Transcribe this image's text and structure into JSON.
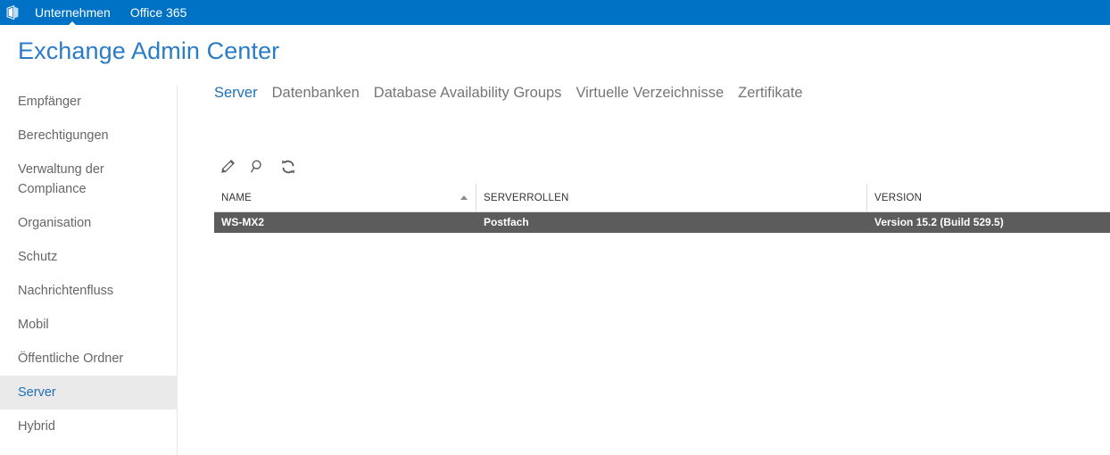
{
  "suite_bar": {
    "logo_icon": "office-logo-icon",
    "links": [
      {
        "label": "Unternehmen",
        "active": true
      },
      {
        "label": "Office 365",
        "active": false
      }
    ]
  },
  "header": {
    "title": "Exchange Admin Center"
  },
  "sidebar": {
    "items": [
      {
        "label": "Empfänger",
        "selected": false
      },
      {
        "label": "Berechtigungen",
        "selected": false
      },
      {
        "label": "Verwaltung der Compliance",
        "selected": false
      },
      {
        "label": "Organisation",
        "selected": false
      },
      {
        "label": "Schutz",
        "selected": false
      },
      {
        "label": "Nachrichtenfluss",
        "selected": false
      },
      {
        "label": "Mobil",
        "selected": false
      },
      {
        "label": "Öffentliche Ordner",
        "selected": false
      },
      {
        "label": "Server",
        "selected": true
      },
      {
        "label": "Hybrid",
        "selected": false
      }
    ]
  },
  "main": {
    "tabs": [
      {
        "label": "Server",
        "active": true
      },
      {
        "label": "Datenbanken",
        "active": false
      },
      {
        "label": "Database Availability Groups",
        "active": false
      },
      {
        "label": "Virtuelle Verzeichnisse",
        "active": false
      },
      {
        "label": "Zertifikate",
        "active": false
      }
    ],
    "toolbar": [
      {
        "icon": "pencil-edit-icon",
        "label": "Bearbeiten"
      },
      {
        "icon": "search-magnifier-icon",
        "label": "Suchen"
      },
      {
        "icon": "refresh-icon",
        "label": "Aktualisieren"
      }
    ],
    "table": {
      "columns": [
        {
          "label": "NAME",
          "sorted": "asc"
        },
        {
          "label": "SERVERROLLEN",
          "sorted": ""
        },
        {
          "label": "VERSION",
          "sorted": ""
        }
      ],
      "rows": [
        {
          "name": "WS-MX2",
          "serverrollen": "Postfach",
          "version": "Version 15.2 (Build 529.5)",
          "selected": true
        }
      ]
    }
  },
  "colors": {
    "suite_bar_blue": "#0072c6",
    "title_blue": "#2a7cc7",
    "link_blue": "#1f6fb7",
    "selected_row_gray": "#5c5c5c",
    "selected_nav_gray": "#eaeaea"
  }
}
